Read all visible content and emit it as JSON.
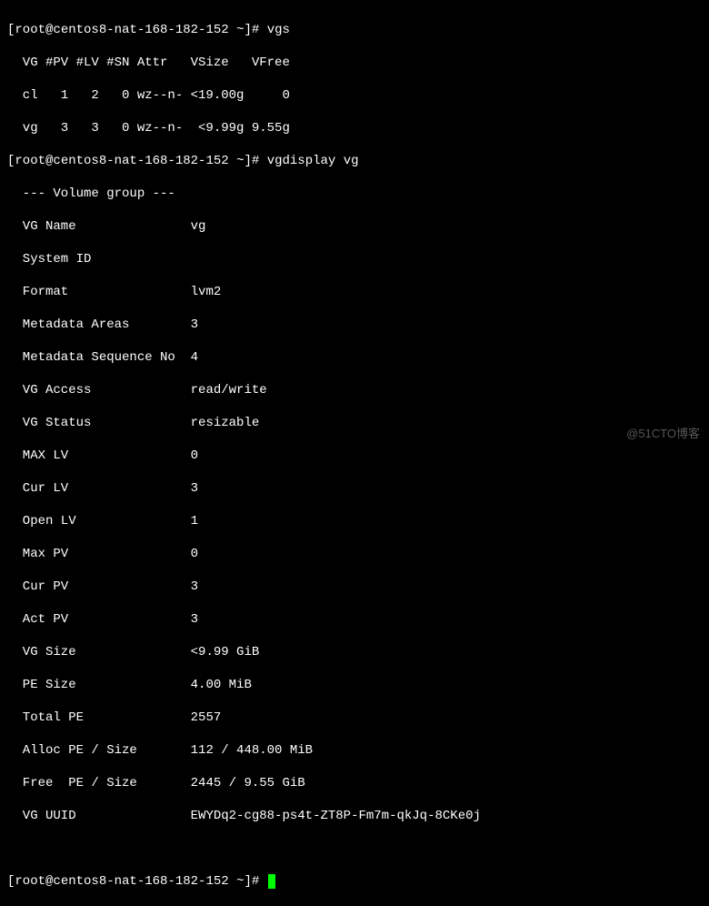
{
  "prompt": {
    "user": "root",
    "host": "centos8-nat-168-182-152",
    "path": "~",
    "symbol": "#"
  },
  "commands": {
    "vgs": "vgs",
    "vgdisplay": "vgdisplay vg",
    "empty": ""
  },
  "vgs_output": {
    "header": "  VG #PV #LV #SN Attr   VSize   VFree",
    "rows": [
      "  cl   1   2   0 wz--n- <19.00g     0",
      "  vg   3   3   0 wz--n-  <9.99g 9.55g"
    ]
  },
  "vgdisplay_output": {
    "header": "  --- Volume group ---",
    "fields": [
      {
        "label": "  VG Name               ",
        "value": "vg"
      },
      {
        "label": "  System ID",
        "value": ""
      },
      {
        "label": "  Format                ",
        "value": "lvm2"
      },
      {
        "label": "  Metadata Areas        ",
        "value": "3"
      },
      {
        "label": "  Metadata Sequence No  ",
        "value": "4"
      },
      {
        "label": "  VG Access             ",
        "value": "read/write"
      },
      {
        "label": "  VG Status             ",
        "value": "resizable"
      },
      {
        "label": "  MAX LV                ",
        "value": "0"
      },
      {
        "label": "  Cur LV                ",
        "value": "3"
      },
      {
        "label": "  Open LV               ",
        "value": "1"
      },
      {
        "label": "  Max PV                ",
        "value": "0"
      },
      {
        "label": "  Cur PV                ",
        "value": "3"
      },
      {
        "label": "  Act PV                ",
        "value": "3"
      },
      {
        "label": "  VG Size               ",
        "value": "<9.99 GiB"
      },
      {
        "label": "  PE Size               ",
        "value": "4.00 MiB"
      },
      {
        "label": "  Total PE              ",
        "value": "2557"
      },
      {
        "label": "  Alloc PE / Size       ",
        "value": "112 / 448.00 MiB"
      },
      {
        "label": "  Free  PE / Size       ",
        "value": "2445 / 9.55 GiB"
      },
      {
        "label": "  VG UUID               ",
        "value": "EWYDq2-cg88-ps4t-ZT8P-Fm7m-qkJq-8CKe0j"
      }
    ]
  },
  "watermark": "@51CTO博客"
}
